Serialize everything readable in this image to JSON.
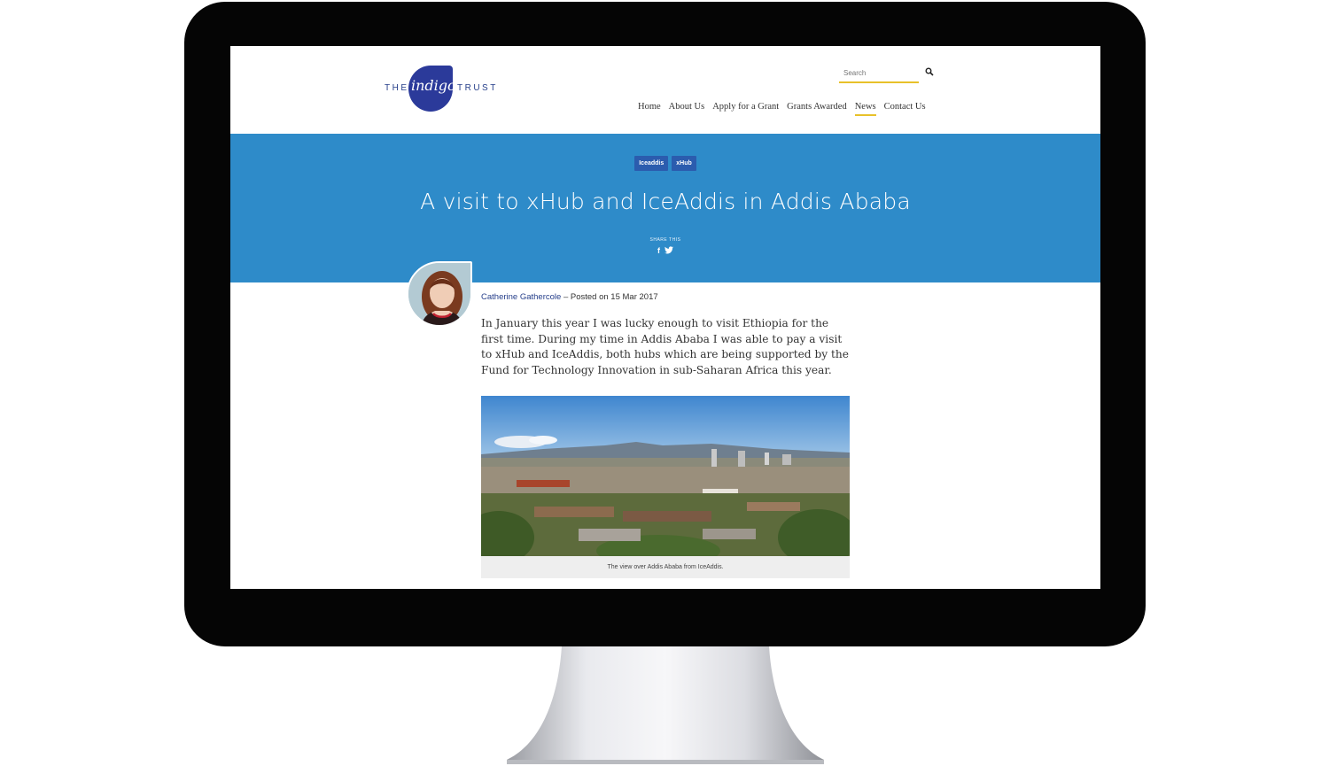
{
  "logo": {
    "the": "THE",
    "indigo": "indigo",
    "trust": "TRUST"
  },
  "search": {
    "placeholder": "Search"
  },
  "nav": [
    {
      "label": "Home"
    },
    {
      "label": "About Us"
    },
    {
      "label": "Apply for a Grant"
    },
    {
      "label": "Grants Awarded"
    },
    {
      "label": "News",
      "active": true
    },
    {
      "label": "Contact Us"
    }
  ],
  "hero": {
    "tags": [
      "Iceaddis",
      "xHub"
    ],
    "title": "A visit to xHub and IceAddis in Addis Ababa",
    "share_label": "SHARE THIS",
    "share_icons": [
      "facebook-icon",
      "twitter-icon"
    ]
  },
  "article": {
    "author": "Catherine Gathercole",
    "posted": " – Posted on 15 Mar 2017",
    "intro": "In January this year I was lucky enough to visit Ethiopia for the first time. During my time in Addis Ababa I was able to pay a visit to xHub and IceAddis, both hubs which are being supported by the Fund for Technology Innovation in sub-Saharan Africa this year.",
    "image_caption": "The view over Addis Ababa from IceAddis."
  },
  "colors": {
    "hero_bg": "#2e8bc9",
    "tag_bg": "#2b5cae",
    "accent_underline": "#e8c12a",
    "logo_blue": "#2b3a9a"
  }
}
